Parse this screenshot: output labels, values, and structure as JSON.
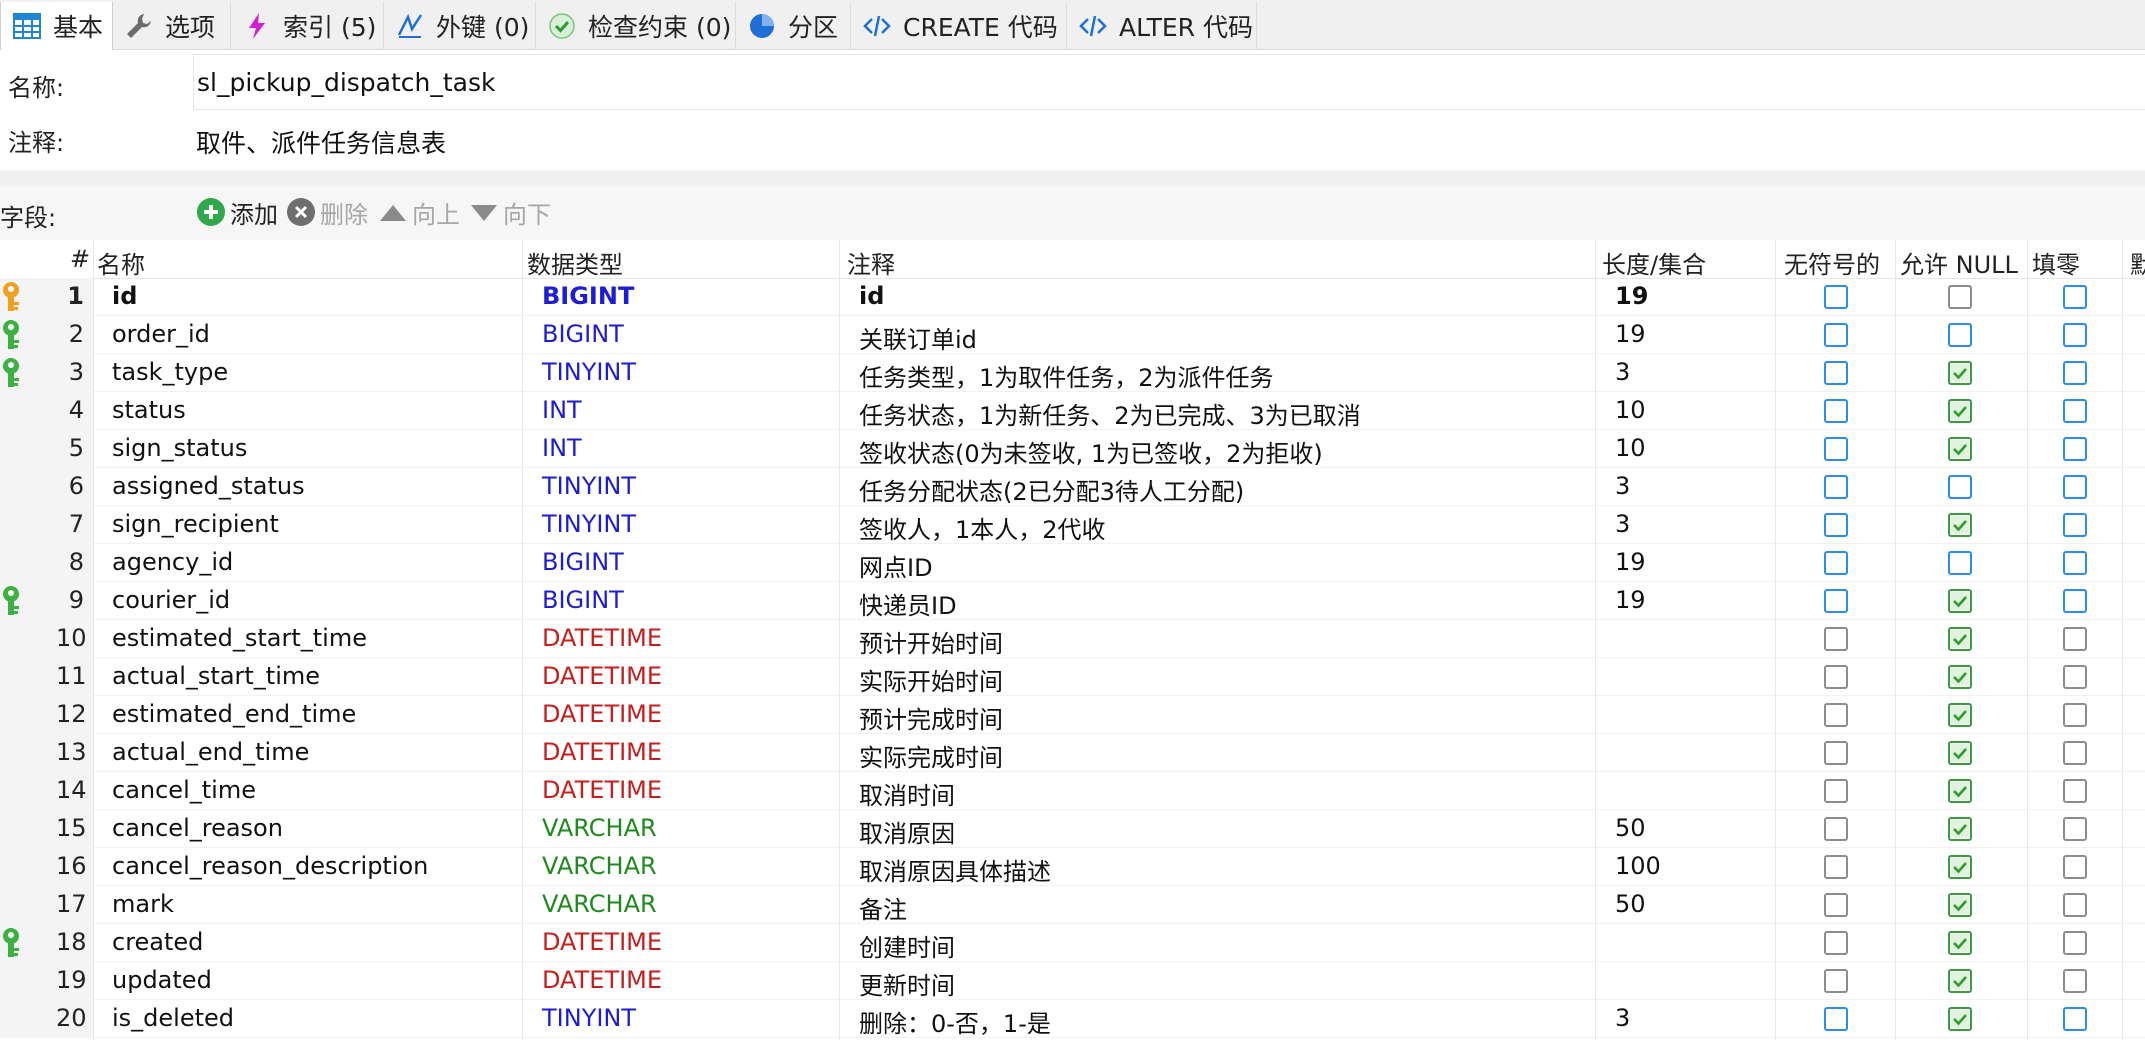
{
  "tabs": [
    {
      "label": "基本",
      "icon": "table-grid-icon",
      "active": true
    },
    {
      "label": "选项",
      "icon": "wrench-icon"
    },
    {
      "label": "索引 (5)",
      "icon": "lightning-icon"
    },
    {
      "label": "外键 (0)",
      "icon": "foreign-key-icon"
    },
    {
      "label": "检查约束 (0)",
      "icon": "check-circle-icon"
    },
    {
      "label": "分区",
      "icon": "pie-chart-icon"
    },
    {
      "label": "CREATE 代码",
      "icon": "code-icon"
    },
    {
      "label": "ALTER 代码",
      "icon": "code-icon"
    }
  ],
  "form": {
    "name_label": "名称:",
    "name_value": "sl_pickup_dispatch_task",
    "comment_label": "注释:",
    "comment_value": "取件、派件任务信息表"
  },
  "fields_toolbar": {
    "label": "字段:",
    "add": "添加",
    "delete": "删除",
    "up": "向上",
    "down": "向下"
  },
  "columns": {
    "num": "#",
    "name": "名称",
    "type": "数据类型",
    "comment": "注释",
    "length": "长度/集合",
    "unsigned": "无符号的",
    "nullable": "允许 NULL",
    "zerofill": "填零",
    "default_partial": "默"
  },
  "colors": {
    "int_type": "#1d1dd6",
    "datetime_type": "#c81d1d",
    "varchar_type": "#1f8a1f",
    "primary_key": "#f0a020",
    "index_key": "#3cb043"
  },
  "rows": [
    {
      "num": "1",
      "name": "id",
      "type": "BIGINT",
      "cls": "int",
      "comment": "id",
      "length": "19",
      "key": "primary",
      "unsigned": "blue",
      "nullable": "grey",
      "zerofill": "blue",
      "bold": true
    },
    {
      "num": "2",
      "name": "order_id",
      "type": "BIGINT",
      "cls": "int",
      "comment": "关联订单id",
      "length": "19",
      "key": "index",
      "unsigned": "blue",
      "nullable": "blue",
      "zerofill": "blue"
    },
    {
      "num": "3",
      "name": "task_type",
      "type": "TINYINT",
      "cls": "int",
      "comment": "任务类型，1为取件任务，2为派件任务",
      "length": "3",
      "key": "index",
      "unsigned": "blue",
      "nullable": "checked",
      "zerofill": "blue"
    },
    {
      "num": "4",
      "name": "status",
      "type": "INT",
      "cls": "int",
      "comment": "任务状态，1为新任务、2为已完成、3为已取消",
      "length": "10",
      "key": "",
      "unsigned": "blue",
      "nullable": "checked",
      "zerofill": "blue"
    },
    {
      "num": "5",
      "name": "sign_status",
      "type": "INT",
      "cls": "int",
      "comment": "签收状态(0为未签收, 1为已签收，2为拒收)",
      "length": "10",
      "key": "",
      "unsigned": "blue",
      "nullable": "checked",
      "zerofill": "blue"
    },
    {
      "num": "6",
      "name": "assigned_status",
      "type": "TINYINT",
      "cls": "int",
      "comment": "任务分配状态(2已分配3待人工分配)",
      "length": "3",
      "key": "",
      "unsigned": "blue",
      "nullable": "blue",
      "zerofill": "blue"
    },
    {
      "num": "7",
      "name": "sign_recipient",
      "type": "TINYINT",
      "cls": "int",
      "comment": "签收人，1本人，2代收",
      "length": "3",
      "key": "",
      "unsigned": "blue",
      "nullable": "checked",
      "zerofill": "blue"
    },
    {
      "num": "8",
      "name": "agency_id",
      "type": "BIGINT",
      "cls": "int",
      "comment": "网点ID",
      "length": "19",
      "key": "",
      "unsigned": "blue",
      "nullable": "blue",
      "zerofill": "blue"
    },
    {
      "num": "9",
      "name": "courier_id",
      "type": "BIGINT",
      "cls": "int",
      "comment": "快递员ID",
      "length": "19",
      "key": "index",
      "unsigned": "blue",
      "nullable": "checked",
      "zerofill": "blue"
    },
    {
      "num": "10",
      "name": "estimated_start_time",
      "type": "DATETIME",
      "cls": "dt",
      "comment": "预计开始时间",
      "length": "",
      "key": "",
      "unsigned": "grey",
      "nullable": "checked",
      "zerofill": "grey"
    },
    {
      "num": "11",
      "name": "actual_start_time",
      "type": "DATETIME",
      "cls": "dt",
      "comment": "实际开始时间",
      "length": "",
      "key": "",
      "unsigned": "grey",
      "nullable": "checked",
      "zerofill": "grey"
    },
    {
      "num": "12",
      "name": "estimated_end_time",
      "type": "DATETIME",
      "cls": "dt",
      "comment": "预计完成时间",
      "length": "",
      "key": "",
      "unsigned": "grey",
      "nullable": "checked",
      "zerofill": "grey"
    },
    {
      "num": "13",
      "name": "actual_end_time",
      "type": "DATETIME",
      "cls": "dt",
      "comment": "实际完成时间",
      "length": "",
      "key": "",
      "unsigned": "grey",
      "nullable": "checked",
      "zerofill": "grey"
    },
    {
      "num": "14",
      "name": "cancel_time",
      "type": "DATETIME",
      "cls": "dt",
      "comment": "取消时间",
      "length": "",
      "key": "",
      "unsigned": "grey",
      "nullable": "checked",
      "zerofill": "grey"
    },
    {
      "num": "15",
      "name": "cancel_reason",
      "type": "VARCHAR",
      "cls": "vc",
      "comment": "取消原因",
      "length": "50",
      "key": "",
      "unsigned": "grey",
      "nullable": "checked",
      "zerofill": "grey"
    },
    {
      "num": "16",
      "name": "cancel_reason_description",
      "type": "VARCHAR",
      "cls": "vc",
      "comment": "取消原因具体描述",
      "length": "100",
      "key": "",
      "unsigned": "grey",
      "nullable": "checked",
      "zerofill": "grey"
    },
    {
      "num": "17",
      "name": "mark",
      "type": "VARCHAR",
      "cls": "vc",
      "comment": "备注",
      "length": "50",
      "key": "",
      "unsigned": "grey",
      "nullable": "checked",
      "zerofill": "grey"
    },
    {
      "num": "18",
      "name": "created",
      "type": "DATETIME",
      "cls": "dt",
      "comment": "创建时间",
      "length": "",
      "key": "index",
      "unsigned": "grey",
      "nullable": "checked",
      "zerofill": "grey"
    },
    {
      "num": "19",
      "name": "updated",
      "type": "DATETIME",
      "cls": "dt",
      "comment": "更新时间",
      "length": "",
      "key": "",
      "unsigned": "grey",
      "nullable": "checked",
      "zerofill": "grey"
    },
    {
      "num": "20",
      "name": "is_deleted",
      "type": "TINYINT",
      "cls": "int",
      "comment": "删除：0-否，1-是",
      "length": "3",
      "key": "",
      "unsigned": "blue",
      "nullable": "checked",
      "zerofill": "blue"
    }
  ]
}
